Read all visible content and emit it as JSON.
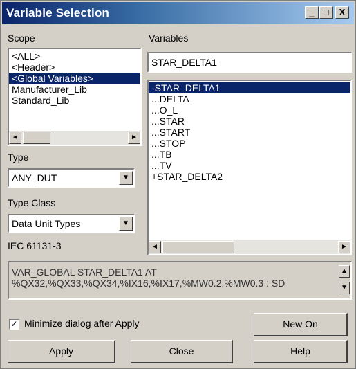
{
  "window": {
    "title": "Variable Selection",
    "min_glyph": "_",
    "max_glyph": "□",
    "close_glyph": "X"
  },
  "scope": {
    "label": "Scope",
    "label_access_key": "o",
    "items": [
      {
        "label": "<ALL>",
        "selected": false
      },
      {
        "label": "<Header>",
        "selected": false
      },
      {
        "label": "<Global Variables>",
        "selected": true
      },
      {
        "label": "Manufacturer_Lib",
        "selected": false
      },
      {
        "label": "Standard_Lib",
        "selected": false
      }
    ]
  },
  "variables": {
    "label": "Variables",
    "input_value": "STAR_DELTA1",
    "items": [
      {
        "label": "-STAR_DELTA1",
        "selected": true
      },
      {
        "label": "...DELTA",
        "selected": false
      },
      {
        "label": "...O_L",
        "selected": false
      },
      {
        "label": "...STAR",
        "selected": false
      },
      {
        "label": "...START",
        "selected": false
      },
      {
        "label": "...STOP",
        "selected": false
      },
      {
        "label": "...TB",
        "selected": false
      },
      {
        "label": "...TV",
        "selected": false
      },
      {
        "label": "+STAR_DELTA2",
        "selected": false
      }
    ]
  },
  "type": {
    "label": "Type",
    "selected_value": "ANY_DUT"
  },
  "type_class": {
    "label": "Type Class",
    "selected_value": "Data Unit Types"
  },
  "standard": {
    "label": "IEC 61131-3"
  },
  "declaration": {
    "line1": "VAR_GLOBAL STAR_DELTA1 AT",
    "line2": "%QX32,%QX33,%QX34,%IX16,%IX17,%MW0.2,%MW0.3 : SD"
  },
  "minimize": {
    "label": "Minimize dialog after Apply",
    "checked": true,
    "check_glyph": "✓"
  },
  "buttons": {
    "new_on": "New On",
    "apply": "Apply",
    "close": "Close",
    "help": "Help"
  },
  "glyphs": {
    "arrow_left": "◄",
    "arrow_right": "►",
    "arrow_down": "▼",
    "arrow_up": "▲"
  },
  "colors": {
    "dialog_bg": "#d4d0c8",
    "selection_bg": "#0a246a",
    "title_gradient_start": "#0a246a",
    "title_gradient_end": "#a6caf0"
  }
}
